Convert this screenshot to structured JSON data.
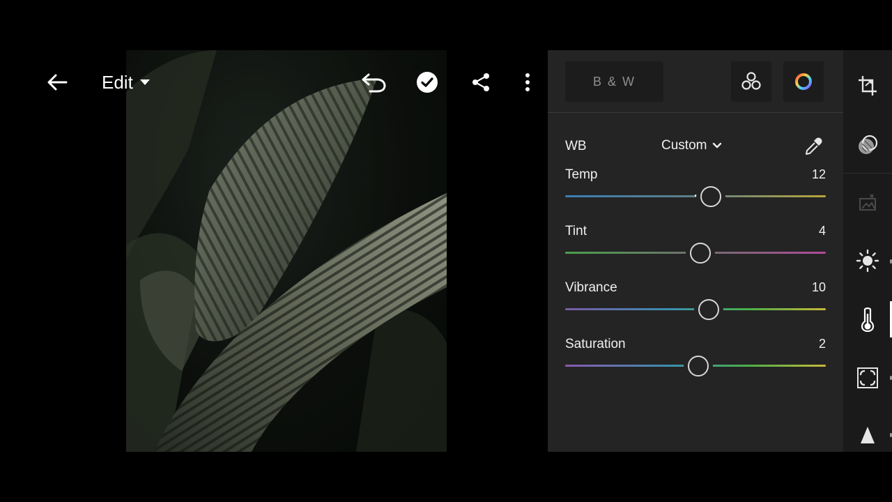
{
  "topbar": {
    "edit_label": "Edit"
  },
  "icons": {
    "back": "arrow-left-icon",
    "dropdown": "caret-down-icon",
    "undo": "undo-icon",
    "done": "checkmark-circle-icon",
    "share": "share-icon",
    "more": "more-vertical-icon",
    "mixer": "color-mixer-icon",
    "grading": "color-wheel-icon",
    "picker": "eyedropper-icon",
    "tools": [
      "crop-icon",
      "selective-icon",
      "healing-icon",
      "light-icon",
      "color-icon",
      "effects-icon",
      "detail-icon"
    ]
  },
  "panel": {
    "bw_label": "B & W",
    "wb": {
      "label": "WB",
      "value": "Custom"
    },
    "sliders": [
      {
        "name": "Temp",
        "value": "12",
        "position": 0.56
      },
      {
        "name": "Tint",
        "value": "4",
        "position": 0.52
      },
      {
        "name": "Vibrance",
        "value": "10",
        "position": 0.55
      },
      {
        "name": "Saturation",
        "value": "2",
        "position": 0.51
      }
    ]
  },
  "colors": {
    "panel_bg": "#242424",
    "rail_bg": "#1a1a1a",
    "accent": "#ffffff"
  }
}
